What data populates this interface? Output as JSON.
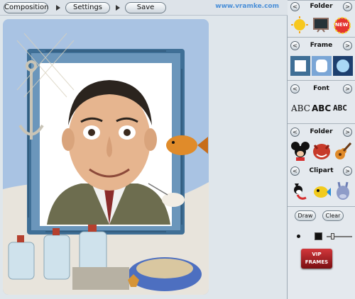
{
  "toolbar": {
    "composition_label": "Composition",
    "settings_label": "Settings",
    "save_label": "Save",
    "brand": "www.vramke.com"
  },
  "panel": {
    "folder_top_title": "Folder",
    "frame_title": "Frame",
    "font_title": "Font",
    "folder_bottom_title": "Folder",
    "clipart_title": "Clipart",
    "font_samples": [
      "ABC",
      "ABC",
      "ABC"
    ],
    "new_badge": "NEW",
    "draw_label": "Draw",
    "clear_label": "Clear",
    "vip_line1": "VIP",
    "vip_line2": "FRAMES",
    "prev_glyph": "<",
    "next_glyph": ">"
  },
  "colors": {
    "brand": "#4a8fd8",
    "vip": "#b8262b",
    "stage_bg": "#6e98cc"
  }
}
